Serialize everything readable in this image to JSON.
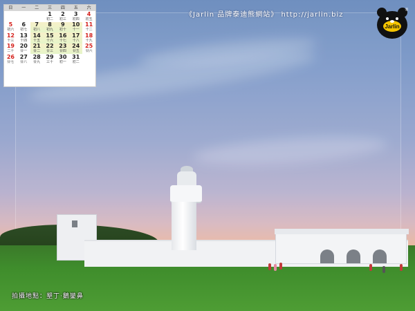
{
  "header": {
    "site_text": "《Jarlin 品牌泰迪熊網站》 http://jarlin.biz",
    "logo_text": "Jarlin",
    "registered_mark": "®"
  },
  "calendar": {
    "weekdays": [
      "日",
      "一",
      "二",
      "三",
      "四",
      "五",
      "六"
    ],
    "rows": [
      [
        {
          "n": "",
          "l": ""
        },
        {
          "n": "",
          "l": ""
        },
        {
          "n": "",
          "l": ""
        },
        {
          "n": "1",
          "l": "初二"
        },
        {
          "n": "2",
          "l": "初三"
        },
        {
          "n": "3",
          "l": "初四"
        },
        {
          "n": "4",
          "l": "初五"
        }
      ],
      [
        {
          "n": "5",
          "l": "初六"
        },
        {
          "n": "6",
          "l": "初七"
        },
        {
          "n": "7",
          "l": "初八"
        },
        {
          "n": "8",
          "l": "初九"
        },
        {
          "n": "9",
          "l": "初十"
        },
        {
          "n": "10",
          "l": "十一"
        },
        {
          "n": "11",
          "l": "十二"
        }
      ],
      [
        {
          "n": "12",
          "l": "十三"
        },
        {
          "n": "13",
          "l": "十四"
        },
        {
          "n": "14",
          "l": "十五"
        },
        {
          "n": "15",
          "l": "十六"
        },
        {
          "n": "16",
          "l": "十七"
        },
        {
          "n": "17",
          "l": "十八"
        },
        {
          "n": "18",
          "l": "十九"
        }
      ],
      [
        {
          "n": "19",
          "l": "二十"
        },
        {
          "n": "20",
          "l": "廿一"
        },
        {
          "n": "21",
          "l": "廿二"
        },
        {
          "n": "22",
          "l": "廿三"
        },
        {
          "n": "23",
          "l": "廿四"
        },
        {
          "n": "24",
          "l": "廿五"
        },
        {
          "n": "25",
          "l": "廿六"
        }
      ],
      [
        {
          "n": "26",
          "l": "廿七"
        },
        {
          "n": "27",
          "l": "廿八"
        },
        {
          "n": "28",
          "l": "廿九"
        },
        {
          "n": "29",
          "l": "三十"
        },
        {
          "n": "30",
          "l": "初一"
        },
        {
          "n": "31",
          "l": "初二"
        },
        {
          "n": "",
          "l": ""
        }
      ]
    ]
  },
  "caption": {
    "text": "拍攝地點：墾丁‧鵝鑾鼻"
  }
}
